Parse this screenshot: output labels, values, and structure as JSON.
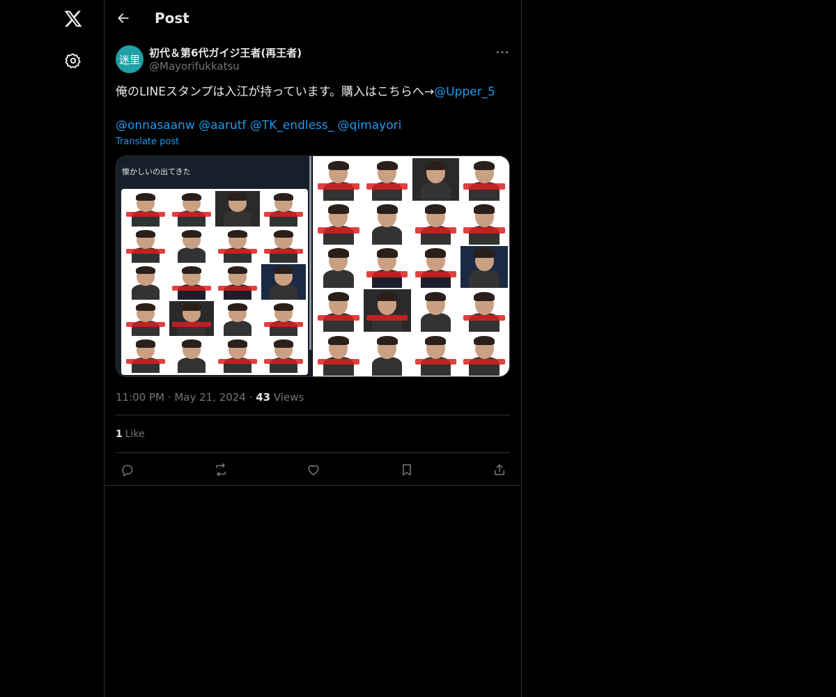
{
  "topbar": {
    "title": "Post"
  },
  "post": {
    "author": {
      "avatar_text": "迷里",
      "name": "初代＆第6代ガイジ王者(再王者)",
      "handle": "@Mayorifukkatsu"
    },
    "text_line1": "俺のLINEスタンプは入江が持っています。購入はこちらへ→",
    "mention_line1": "@Upper_5",
    "mentions_line2": [
      "@onnasaanw",
      "@aarutf",
      "@TK_endless_",
      "@qimayori"
    ],
    "translate_label": "Translate post",
    "media": {
      "left_caption": "懐かしいの出てきた"
    },
    "time": "11:00 PM",
    "date": "May 21, 2024",
    "views_count": "43",
    "views_label": "Views",
    "likes_count": "1",
    "likes_label": "Like"
  },
  "colors": {
    "accent": "#1d9bf0",
    "avatar_bg": "#1f9fa6",
    "border": "#2f3336",
    "muted": "#71767b"
  },
  "icons": {
    "logo": "x-logo-icon",
    "settings": "gear-icon",
    "back": "arrow-left-icon",
    "more": "more-horizontal-icon",
    "reply": "reply-icon",
    "repost": "repost-icon",
    "like": "heart-icon",
    "bookmark": "bookmark-icon",
    "share": "share-icon"
  }
}
